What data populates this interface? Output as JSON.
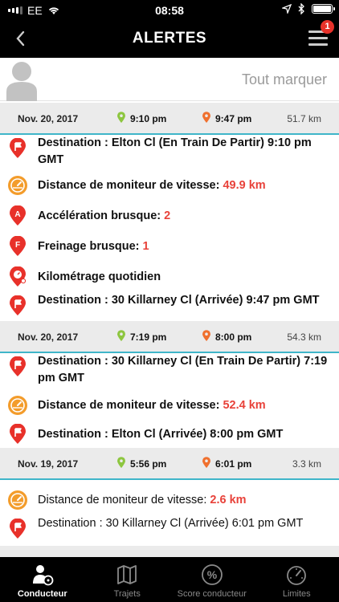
{
  "status": {
    "carrier": "EE",
    "time": "08:58"
  },
  "header": {
    "title": "ALERTES",
    "badge": "1"
  },
  "user": {
    "mark_all": "Tout marquer"
  },
  "trips": [
    {
      "date": "Nov. 20, 2017",
      "start": "9:10 pm",
      "end": "9:47 pm",
      "distance": "51.7 km",
      "events": [
        {
          "label": "Destination : Elton Cl (En Train De Partir) 9:10 pm GMT",
          "value": "",
          "icon": "flag-icon"
        },
        {
          "label": "Distance de moniteur de vitesse: ",
          "value": "49.9 km",
          "icon": "speedometer-icon"
        },
        {
          "label": "Accélération brusque: ",
          "value": "2",
          "icon": "acceleration-icon"
        },
        {
          "label": "Freinage brusque: ",
          "value": "1",
          "icon": "braking-icon"
        },
        {
          "label": "Kilométrage quotidien",
          "value": "",
          "icon": "mileage-icon"
        },
        {
          "label": "Destination : 30 Killarney Cl (Arrivée) 9:47 pm GMT",
          "value": "",
          "icon": "flag-icon"
        }
      ]
    },
    {
      "date": "Nov. 20, 2017",
      "start": "7:19 pm",
      "end": "8:00 pm",
      "distance": "54.3 km",
      "events": [
        {
          "label": "Destination : 30 Killarney Cl (En Train De Partir) 7:19 pm GMT",
          "value": "",
          "icon": "flag-icon"
        },
        {
          "label": "Distance de moniteur de vitesse: ",
          "value": "52.4 km",
          "icon": "speedometer-icon"
        },
        {
          "label": "Destination : Elton Cl (Arrivée) 8:00 pm GMT",
          "value": "",
          "icon": "flag-icon"
        }
      ]
    },
    {
      "date": "Nov. 19, 2017",
      "start": "5:56 pm",
      "end": "6:01 pm",
      "distance": "3.3 km",
      "events": [
        {
          "label": "Distance de moniteur de vitesse: ",
          "value": "2.6 km",
          "icon": "speedometer-icon"
        },
        {
          "label": "Destination : 30 Killarney Cl (Arrivée) 6:01 pm GMT",
          "value": "",
          "icon": "flag-icon"
        }
      ]
    }
  ],
  "tabs": [
    {
      "label": "Conducteur",
      "icon": "driver-icon",
      "active": true
    },
    {
      "label": "Trajets",
      "icon": "map-icon",
      "active": false
    },
    {
      "label": "Score conducteur",
      "icon": "percent-icon",
      "active": false
    },
    {
      "label": "Limites",
      "icon": "gauge-icon",
      "active": false
    }
  ],
  "colors": {
    "accent_red": "#e8312a",
    "value_red": "#e8423a",
    "teal": "#3fb5c9",
    "green_pin": "#8dc63f",
    "orange_pin": "#f0702e",
    "speed_orange": "#f39c2b"
  }
}
